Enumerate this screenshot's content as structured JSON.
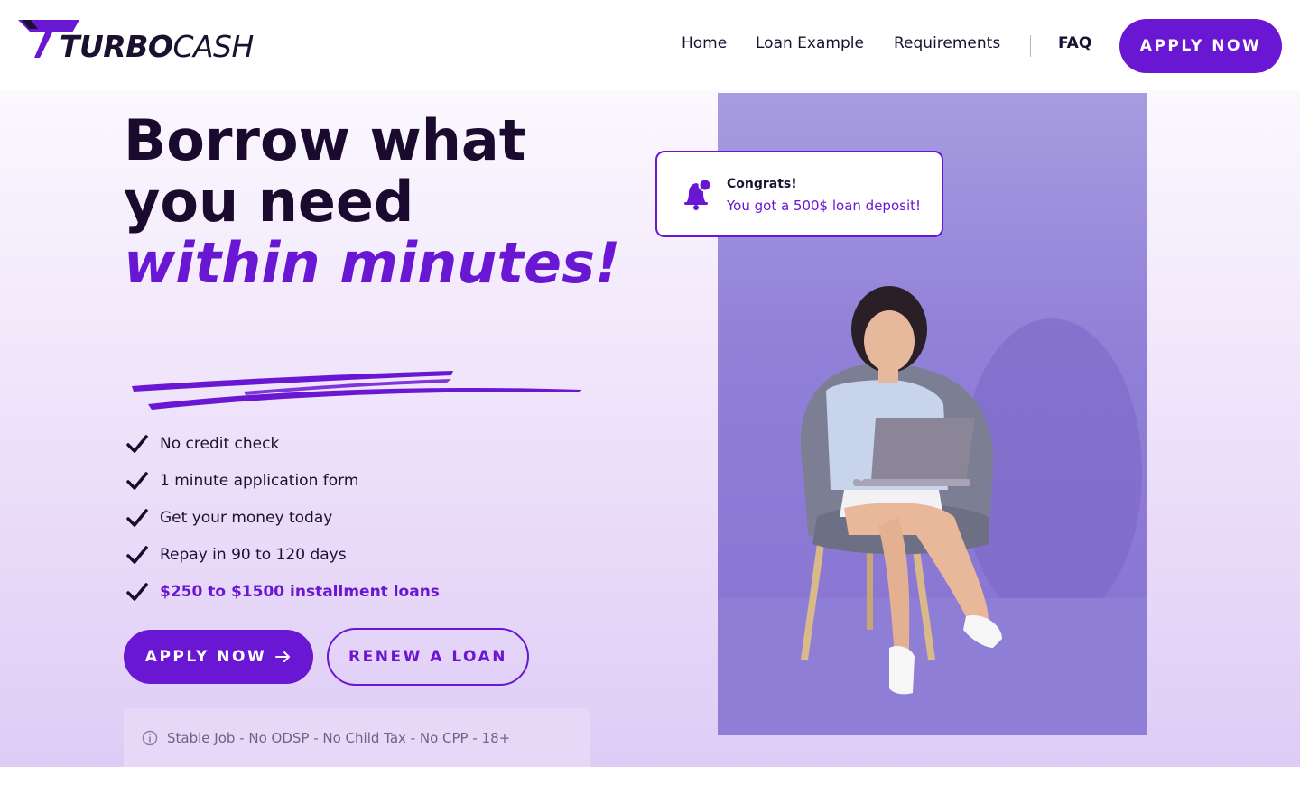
{
  "brand": {
    "name_bold": "TURBO",
    "name_light": "CASH",
    "accent_color": "#6a17d3"
  },
  "nav": {
    "links": [
      "Home",
      "Loan Example",
      "Requirements"
    ],
    "faq": "FAQ",
    "apply_label": "APPLY NOW"
  },
  "hero": {
    "headline_line1": "Borrow what you need",
    "headline_accent": "within minutes!",
    "features": [
      "No credit check",
      "1 minute application form",
      "Get your money today",
      "Repay in 90 to 120 days",
      "$250 to $1500 installment loans"
    ],
    "apply_button": "APPLY NOW",
    "apply_button_icon": "arrow-right-icon",
    "renew_button": "RENEW A LOAN",
    "requirements": "Stable Job - No ODSP - No Child Tax - No CPP - 18+"
  },
  "notification": {
    "icon": "bell-icon",
    "title": "Congrats!",
    "message": "You got a 500$ loan deposit!"
  }
}
